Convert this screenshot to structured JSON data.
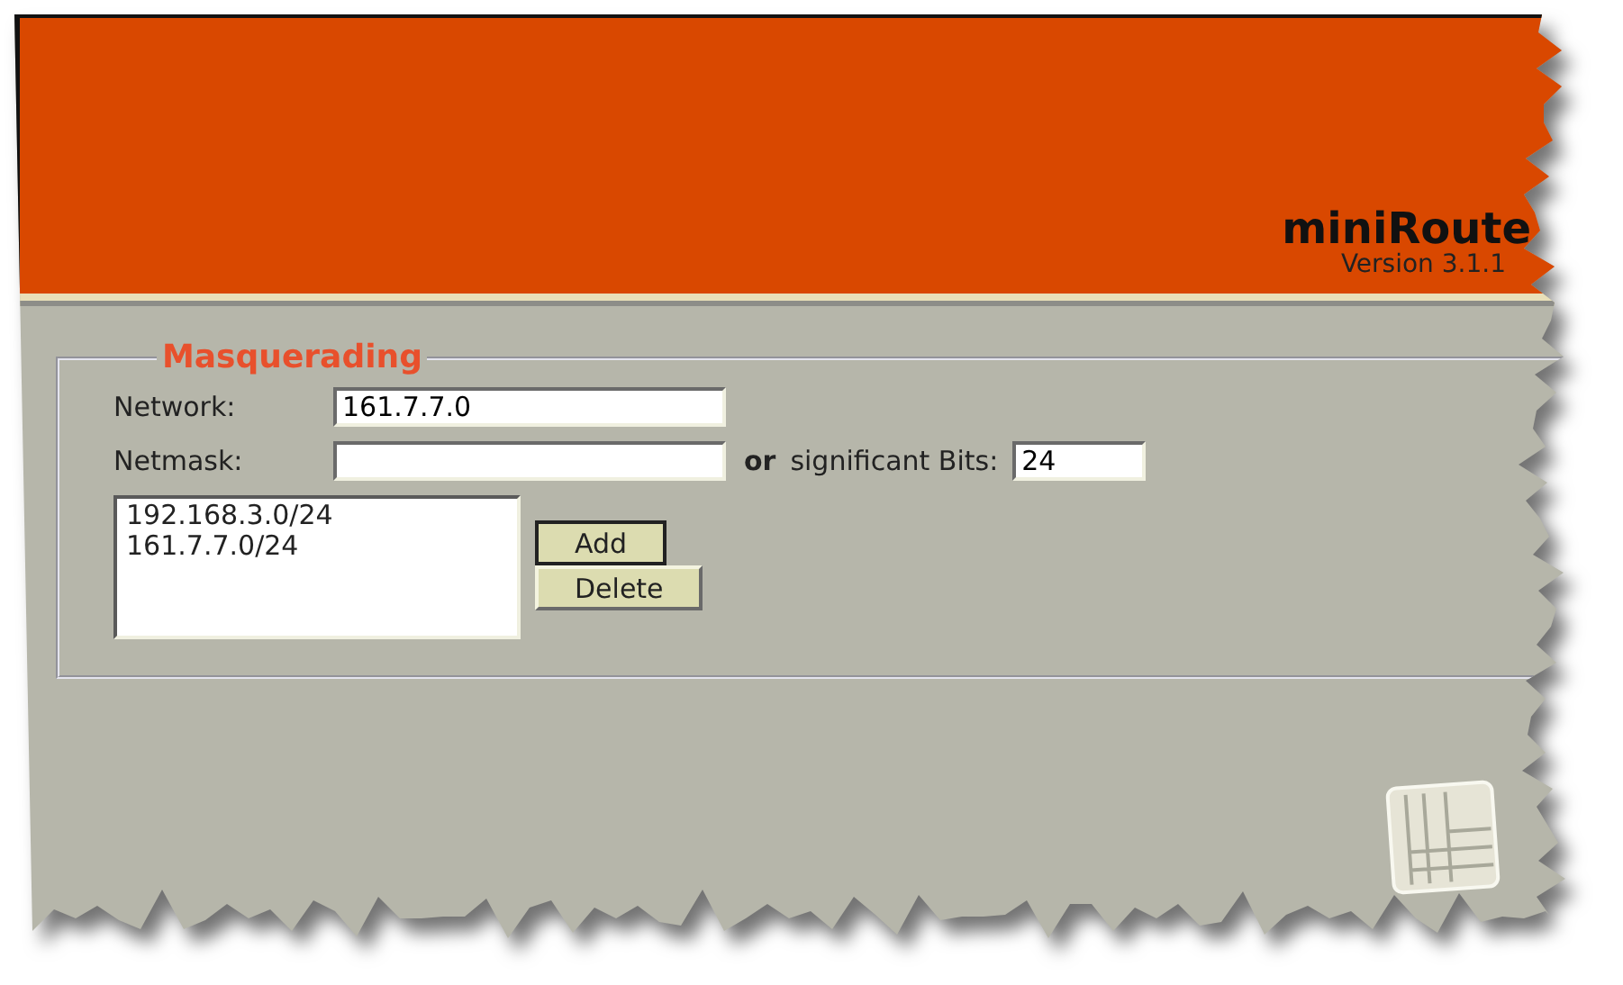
{
  "header": {
    "title": "miniRoute",
    "version": "Version 3.1.1"
  },
  "section": {
    "legend": "Masquerading",
    "network": {
      "label": "Network:",
      "value": "161.7.7.0"
    },
    "netmask": {
      "label": "Netmask:"
    },
    "bits": {
      "joiner": "or",
      "label": "significant Bits:",
      "value": "24"
    },
    "entries": [
      "192.168.3.0/24",
      "161.7.7.0/24"
    ],
    "buttons": [
      {
        "label": "Add",
        "default": true
      },
      {
        "label": "Delete",
        "default": false
      }
    ]
  }
}
